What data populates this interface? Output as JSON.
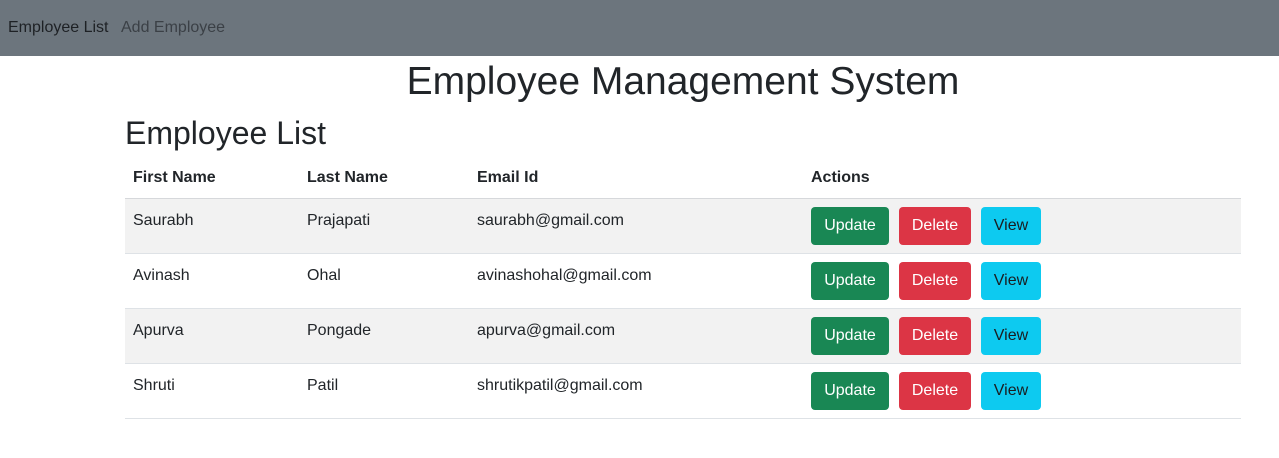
{
  "navbar": {
    "links": [
      {
        "label": "Employee List"
      },
      {
        "label": "Add Employee"
      }
    ]
  },
  "app_title": "Employee Management System",
  "page_title": "Employee List",
  "table": {
    "headers": [
      "First Name",
      "Last Name",
      "Email Id",
      "Actions"
    ],
    "rows": [
      {
        "first": "Saurabh",
        "last": "Prajapati",
        "email": "saurabh@gmail.com"
      },
      {
        "first": "Avinash",
        "last": "Ohal",
        "email": "avinashohal@gmail.com"
      },
      {
        "first": "Apurva",
        "last": "Pongade",
        "email": "apurva@gmail.com"
      },
      {
        "first": "Shruti",
        "last": "Patil",
        "email": "shrutikpatil@gmail.com"
      }
    ],
    "actions": {
      "update": "Update",
      "delete": "Delete",
      "view": "View"
    }
  },
  "colors": {
    "navbar": "#6c757d",
    "update": "#198754",
    "delete": "#dc3545",
    "view": "#0dcaf0",
    "striped_row": "#f2f2f2"
  }
}
